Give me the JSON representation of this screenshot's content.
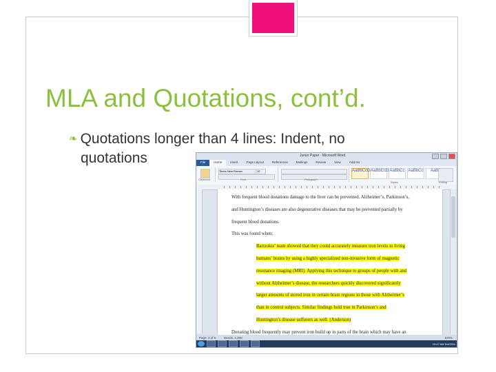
{
  "slide": {
    "title": "MLA and Quotations, cont’d.",
    "bullet_line1": "Quotations longer than 4 lines: Indent, no",
    "bullet_line2": "quotations",
    "bullet_icon": "bullet-flourish-icon"
  },
  "colors": {
    "title": "#8cbf3f",
    "accent_tab": "#f0107b",
    "highlight": "#ffff00"
  },
  "word": {
    "window_title": "Junior Paper - Microsoft Word",
    "tabs": [
      "File",
      "Home",
      "Insert",
      "Page Layout",
      "References",
      "Mailings",
      "Review",
      "View",
      "Add-Ins"
    ],
    "active_tab": "Home",
    "font_name": "Times New Roman",
    "font_size": "12",
    "styles": [
      "AaBbCcDc",
      "AaBbCcDc",
      "AaBbCc",
      "AaBbCc",
      "AaB"
    ],
    "group_labels": [
      "Clipboard",
      "Font",
      "Paragraph",
      "Styles",
      "Editing"
    ],
    "doc_lines": [
      {
        "text": "With frequent blood donations damage to the liver can be prevented. Alzheimer’s, Parkinson’s,",
        "hl": false,
        "indent": false
      },
      {
        "text": "and Huntington’s diseases are also degenerative diseases that may be prevented partially by",
        "hl": false,
        "indent": false
      },
      {
        "text": "frequent blood donations.",
        "hl": false,
        "indent": false
      },
      {
        "text": "This was found when:",
        "hl": false,
        "indent": false
      },
      {
        "text": "Bartzokis’ team showed that they could accurately measure iron levels in living",
        "hl": true,
        "indent": true
      },
      {
        "text": "humans’ brains by using a highly specialized non-invasive form of magnetic",
        "hl": true,
        "indent": true
      },
      {
        "text": "resonance imaging (MRI). Applying this technique to groups of people with and",
        "hl": true,
        "indent": true
      },
      {
        "text": "without Alzheimer’s disease, the researchers quickly discovered significantly",
        "hl": true,
        "indent": true
      },
      {
        "text": "larger amounts of stored iron in certain brain regions in those with Alzheimer’s",
        "hl": true,
        "indent": true
      },
      {
        "text": "than in control subjects. Similar findings hold true in Parkinson’s and",
        "hl": true,
        "indent": true
      },
      {
        "text": "Huntington’s disease sufferers as well. (Anderson)",
        "hl": true,
        "indent": true
      },
      {
        "text": "Donating blood frequently may prevent iron build up in parts of the brain which may have an",
        "hl": false,
        "indent": false
      }
    ],
    "status_page": "Page: 3 of 6",
    "status_words": "Words: 2,300",
    "zoom": "100%",
    "clock_time": "10:47 AM",
    "clock_date": "5/4/2011"
  }
}
